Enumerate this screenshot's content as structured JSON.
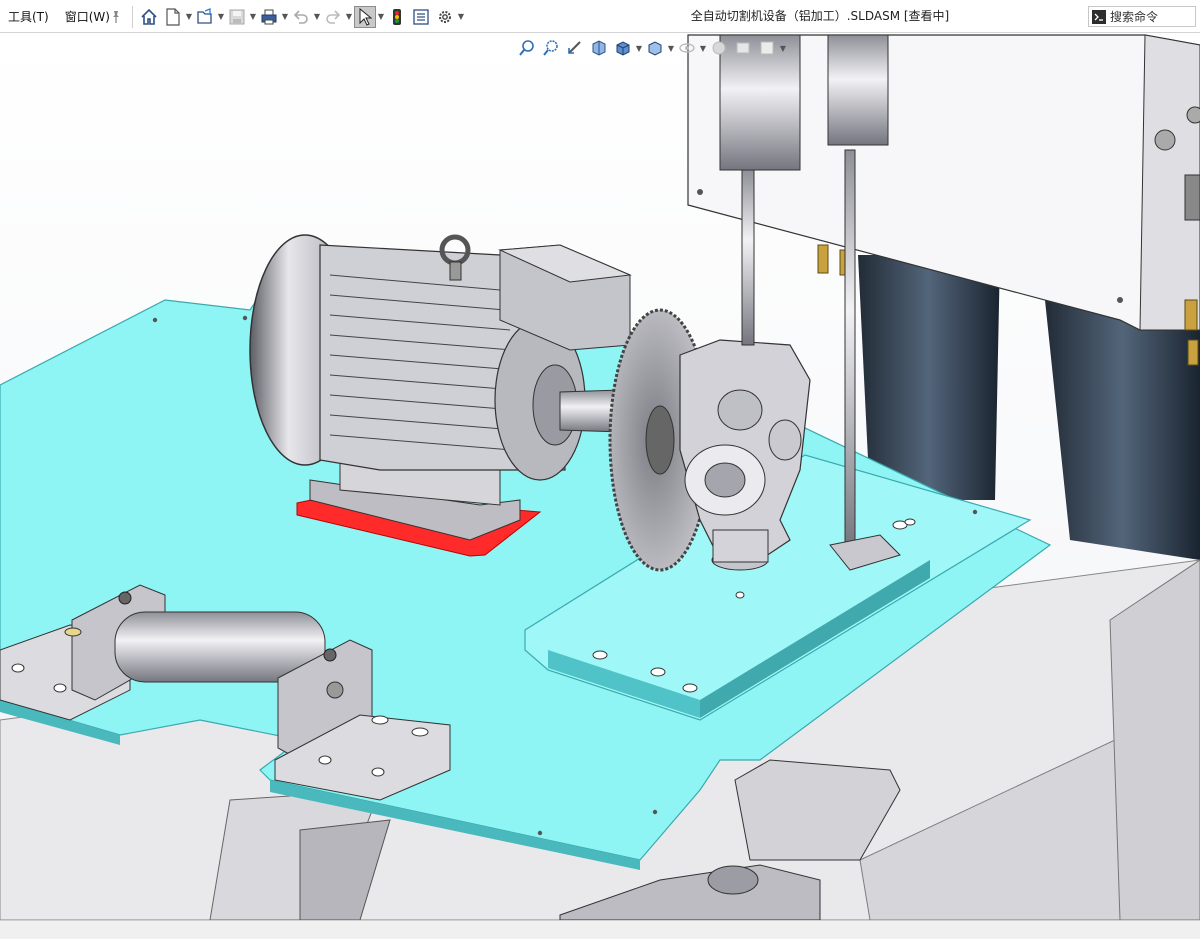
{
  "menu": {
    "tools_label": "工具(T)",
    "window_label": "窗口(W)"
  },
  "toolbar": {
    "icons": [
      "pin-icon",
      "home-icon",
      "new-document-icon",
      "open-icon",
      "save-icon",
      "print-icon",
      "undo-icon",
      "redo-icon",
      "select-icon",
      "rebuild-icon",
      "file-properties-icon",
      "options-icon"
    ]
  },
  "document": {
    "title": "全自动切割机设备（铝加工）.SLDASM [查看中]"
  },
  "search": {
    "placeholder": "搜索命令"
  },
  "heads_up_toolbar": {
    "icons": [
      "zoom-to-fit-icon",
      "zoom-to-area-icon",
      "previous-view-icon",
      "section-view-icon",
      "view-orientation-icon",
      "display-style-icon",
      "hide-show-icon",
      "edit-appearance-icon",
      "apply-scene-icon",
      "view-settings-icon"
    ]
  },
  "colors": {
    "plate": "#8ef4f4",
    "plate_edge": "#49b9bd",
    "metal": "#c9c9cf",
    "dark_metal": "#7a7a84",
    "highlight": "#ff2b2b",
    "background_shadow": "#1f2b38"
  }
}
